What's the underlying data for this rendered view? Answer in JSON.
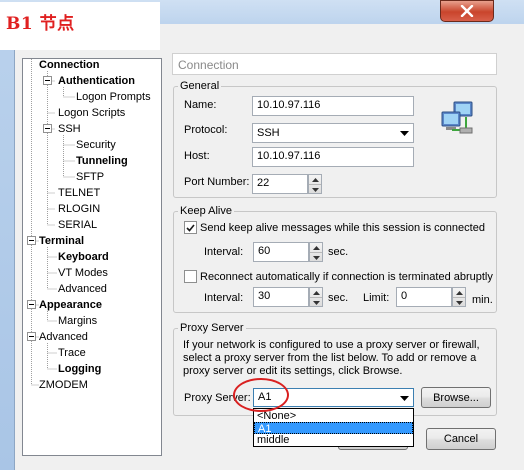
{
  "banner": {
    "text": "B1 节点"
  },
  "window": {
    "close_icon": "close-icon"
  },
  "tree": [
    {
      "label": "Connection",
      "bold": true
    },
    {
      "label": "Authentication",
      "bold": true
    },
    {
      "label": "Logon Prompts",
      "bold": false
    },
    {
      "label": "Logon Scripts",
      "bold": false
    },
    {
      "label": "SSH",
      "bold": false
    },
    {
      "label": "Security",
      "bold": false
    },
    {
      "label": "Tunneling",
      "bold": true
    },
    {
      "label": "SFTP",
      "bold": false
    },
    {
      "label": "TELNET",
      "bold": false
    },
    {
      "label": "RLOGIN",
      "bold": false
    },
    {
      "label": "SERIAL",
      "bold": false
    },
    {
      "label": "Terminal",
      "bold": true
    },
    {
      "label": "Keyboard",
      "bold": true
    },
    {
      "label": "VT Modes",
      "bold": false
    },
    {
      "label": "Advanced",
      "bold": false
    },
    {
      "label": "Appearance",
      "bold": true
    },
    {
      "label": "Margins",
      "bold": false
    },
    {
      "label": "Advanced",
      "bold": false
    },
    {
      "label": "Trace",
      "bold": false
    },
    {
      "label": "Logging",
      "bold": true
    },
    {
      "label": "ZMODEM",
      "bold": false
    }
  ],
  "panel": {
    "title": "Connection"
  },
  "general": {
    "legend": "General",
    "name_label": "Name:",
    "name_value": "10.10.97.116",
    "protocol_label": "Protocol:",
    "protocol_value": "SSH",
    "host_label": "Host:",
    "host_value": "10.10.97.116",
    "port_label": "Port Number:",
    "port_value": "22",
    "network_icon": "network-computers-icon"
  },
  "keepalive": {
    "legend": "Keep Alive",
    "send_label": "Send keep alive messages while this session is connected",
    "send_checked": true,
    "interval_label": "Interval:",
    "interval_value": "60",
    "interval_unit": "sec.",
    "reconnect_label": "Reconnect automatically if connection is terminated abruptly",
    "reconnect_checked": false,
    "interval2_label": "Interval:",
    "interval2_value": "30",
    "interval2_unit": "sec.",
    "limit_label": "Limit:",
    "limit_value": "0",
    "limit_unit": "min."
  },
  "proxy": {
    "legend": "Proxy Server",
    "description": "If your network is configured to use a proxy server or firewall, select a proxy server from the list below. To add or remove a proxy server or edit its settings, click Browse.",
    "label": "Proxy Server:",
    "value": "A1",
    "browse_label": "Browse...",
    "options": [
      "<None>",
      "A1",
      "middle"
    ],
    "selected_index": 1
  },
  "buttons": {
    "cancel_label": "Cancel"
  },
  "colors": {
    "annotation": "#d92020",
    "selection": "#3399ff",
    "banner_text": "#e02020"
  }
}
